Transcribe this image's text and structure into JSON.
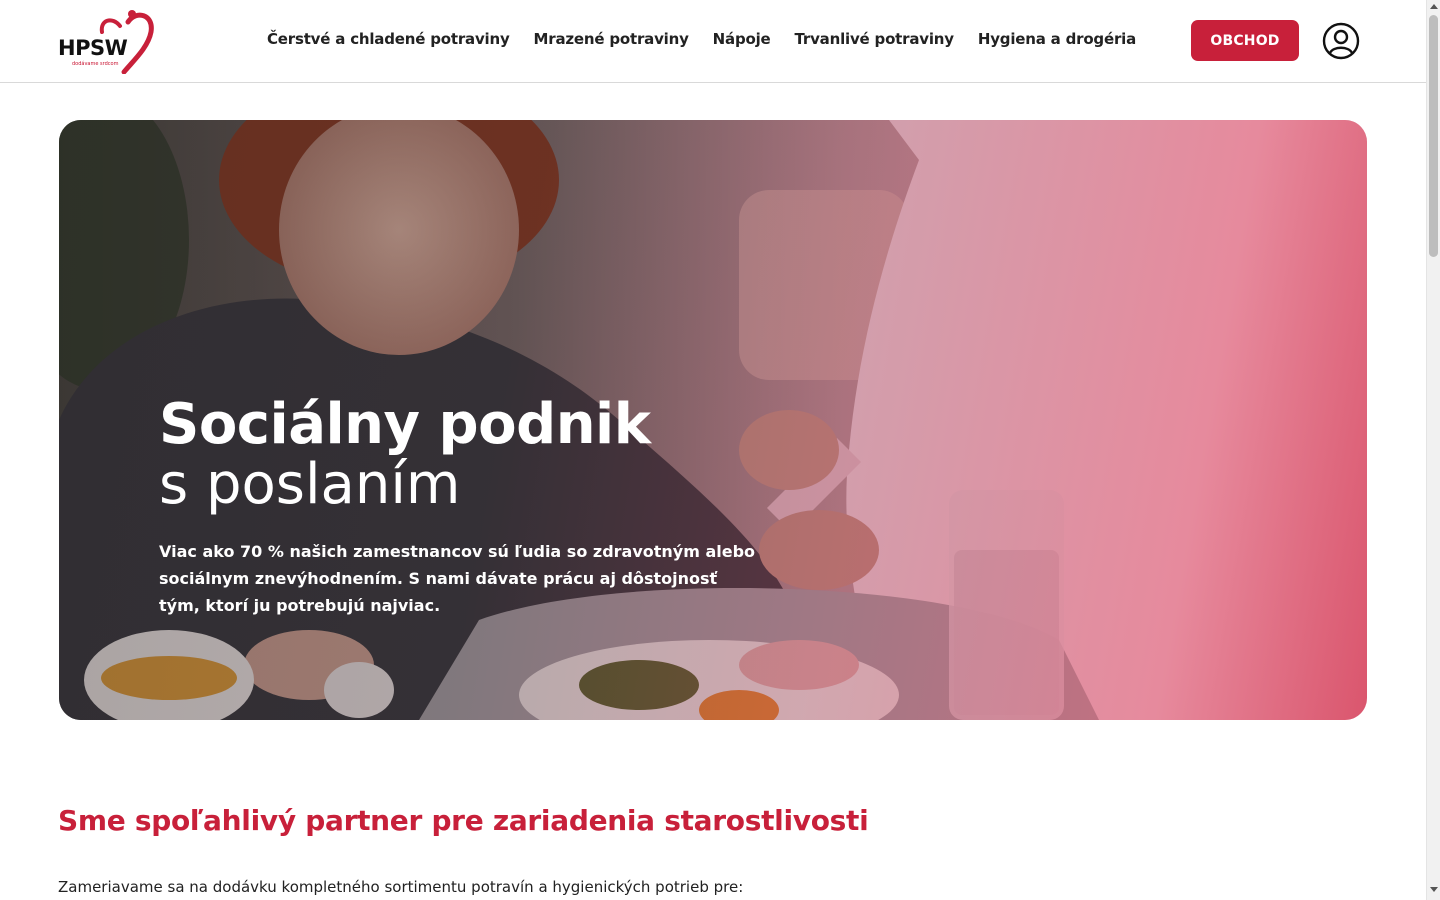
{
  "brand": {
    "logo_text": "HPSW",
    "tagline": "dodávame srdcom",
    "accent_color": "#c8203a"
  },
  "nav": {
    "items": [
      {
        "label": "Čerstvé a chladené potraviny"
      },
      {
        "label": "Mrazené potraviny"
      },
      {
        "label": "Nápoje"
      },
      {
        "label": "Trvanlivé potraviny"
      },
      {
        "label": "Hygiena a drogéria"
      }
    ]
  },
  "header": {
    "shop_label": "OBCHOD",
    "user_icon": "user-circle-icon"
  },
  "hero": {
    "title_line1": "Sociálny podnik",
    "title_line2": "s poslaním",
    "text": "Viac ako 70 % našich zamestnancov sú ľudia so zdravotným alebo sociálnym znevýhodnením. S nami dávate prácu aj dôstojnosť tým, ktorí ju potrebujú najviac."
  },
  "section": {
    "title": "Sme spoľahlivý partner pre zariadenia starostlivosti",
    "text": "Zameriavame sa na dodávku kompletného sortimentu potravín a hygienických potrieb pre:"
  }
}
